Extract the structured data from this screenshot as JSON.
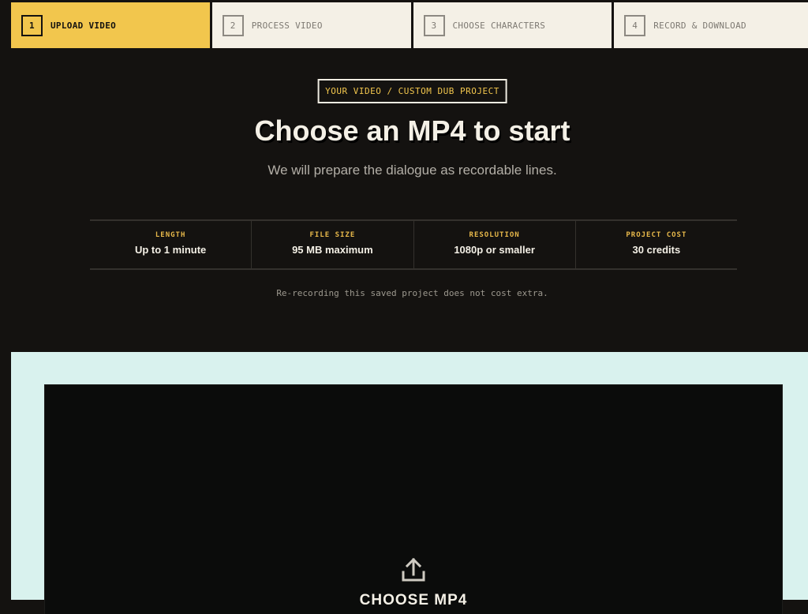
{
  "steps": [
    {
      "number": "1",
      "label": "UPLOAD VIDEO",
      "active": true
    },
    {
      "number": "2",
      "label": "PROCESS VIDEO",
      "active": false
    },
    {
      "number": "3",
      "label": "CHOOSE CHARACTERS",
      "active": false
    },
    {
      "number": "4",
      "label": "RECORD & DOWNLOAD",
      "active": false
    }
  ],
  "hero": {
    "tag": "YOUR VIDEO / CUSTOM DUB PROJECT",
    "title": "Choose an MP4 to start",
    "subtitle": "We will prepare the dialogue as recordable lines."
  },
  "specs": [
    {
      "label": "LENGTH",
      "value": "Up to 1 minute"
    },
    {
      "label": "FILE SIZE",
      "value": "95 MB maximum"
    },
    {
      "label": "RESOLUTION",
      "value": "1080p or smaller"
    },
    {
      "label": "PROJECT COST",
      "value": "30 credits"
    }
  ],
  "note": "Re-recording this saved project does not cost extra.",
  "upload": {
    "icon": "upload-icon",
    "label": "CHOOSE MP4"
  },
  "colors": {
    "accent": "#f2c64d",
    "background": "#141210",
    "panel": "#d9f2ee"
  }
}
